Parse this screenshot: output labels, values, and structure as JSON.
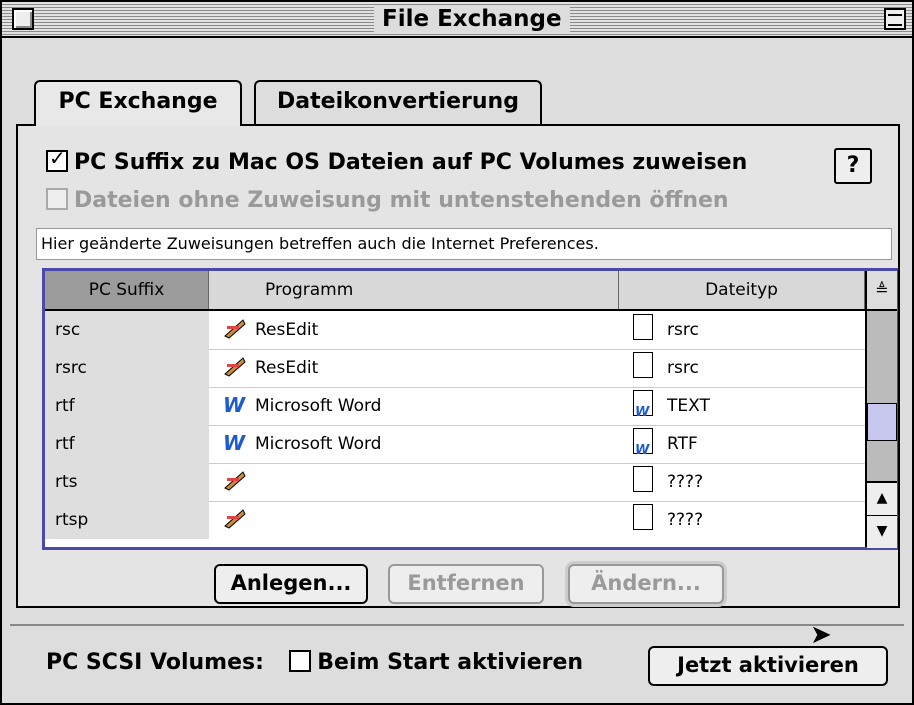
{
  "window": {
    "title": "File Exchange"
  },
  "tabs": [
    {
      "label": "PC Exchange",
      "active": true
    },
    {
      "label": "Dateikonvertierung",
      "active": false
    }
  ],
  "options": {
    "assign_suffix": {
      "label": "PC Suffix zu Mac OS Dateien auf PC Volumes zuweisen",
      "checked": true
    },
    "open_unassigned": {
      "label": "Dateien ohne Zuweisung mit untenstehenden öffnen",
      "checked": false,
      "disabled": true
    },
    "help_icon": "?"
  },
  "note": "Hier geänderte Zuweisungen betreffen auch die Internet Preferences.",
  "table": {
    "columns": [
      "PC Suffix",
      "Programm",
      "Dateityp"
    ],
    "sorted_column": "PC Suffix",
    "rows": [
      {
        "suffix": "rsc",
        "program": "ResEdit",
        "program_icon": "resedit-icon",
        "type": "rsrc",
        "type_icon": "document-icon"
      },
      {
        "suffix": "rsrc",
        "program": "ResEdit",
        "program_icon": "resedit-icon",
        "type": "rsrc",
        "type_icon": "document-icon"
      },
      {
        "suffix": "rtf",
        "program": "Microsoft Word",
        "program_icon": "word-icon",
        "type": "TEXT",
        "type_icon": "word-document-icon"
      },
      {
        "suffix": "rtf",
        "program": "Microsoft Word",
        "program_icon": "word-icon",
        "type": "RTF",
        "type_icon": "word-document-icon"
      },
      {
        "suffix": "rts",
        "program": "",
        "program_icon": "resedit-icon",
        "type": "????",
        "type_icon": "document-icon"
      },
      {
        "suffix": "rtsp",
        "program": "",
        "program_icon": "resedit-icon",
        "type": "????",
        "type_icon": "document-icon"
      }
    ]
  },
  "buttons": {
    "add": "Anlegen...",
    "remove": "Entfernen",
    "change": "Ändern..."
  },
  "footer": {
    "label": "PC SCSI Volumes:",
    "checkbox_label": "Beim Start aktivieren",
    "checkbox_checked": false,
    "activate_now": "Jetzt aktivieren"
  },
  "colors": {
    "table_border": "#4a4aa8",
    "word_blue": "#1e5bd0"
  }
}
